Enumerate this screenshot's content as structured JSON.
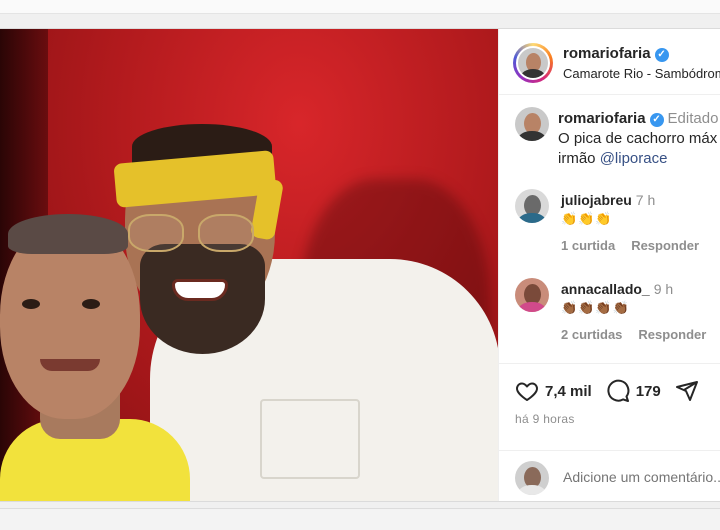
{
  "post": {
    "author": "romariofaria",
    "location": "Camarote Rio - Sambódromo",
    "caption_line1": "O pica de cachorro máx",
    "caption_line2_prefix": "irmão ",
    "caption_mention": "@liporace",
    "edited_label": "Editado",
    "likes": "7,4 mil",
    "comments_count": "179",
    "time_ago": "há 9 horas",
    "add_comment_placeholder": "Adicione um comentário..."
  },
  "comments": [
    {
      "user": "juliojabreu",
      "time": "7 h",
      "emoji": "👏👏👏",
      "likes": "1 curtida",
      "reply": "Responder"
    },
    {
      "user": "annacallado_",
      "time": "9 h",
      "emoji": "👏🏾👏🏾👏🏾👏🏾",
      "likes": "2 curtidas",
      "reply": "Responder"
    }
  ],
  "colors": {
    "verified": "#3897f0",
    "mention": "#385185",
    "muted": "#8e8e8e"
  },
  "icons": [
    "heart-icon",
    "comment-icon",
    "share-icon",
    "verified-icon"
  ]
}
